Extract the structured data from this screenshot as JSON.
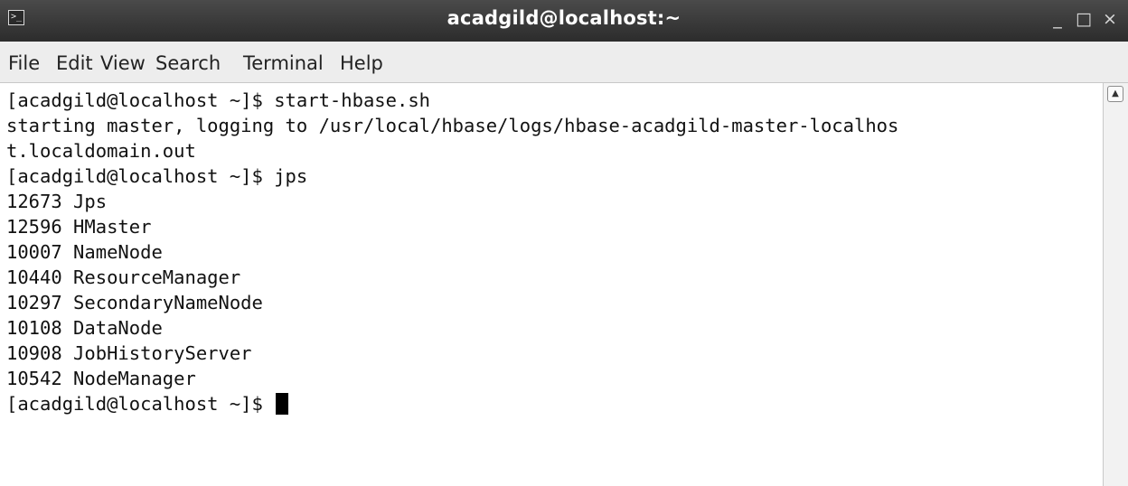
{
  "window": {
    "title": "acadgild@localhost:~",
    "icon": "terminal-icon",
    "controls": {
      "minimize": "_",
      "maximize": "□",
      "close": "×"
    }
  },
  "menubar": {
    "items": [
      "File",
      "Edit",
      "View",
      "Search",
      "Terminal",
      "Help"
    ]
  },
  "terminal": {
    "lines": [
      "[acadgild@localhost ~]$ start-hbase.sh",
      "starting master, logging to /usr/local/hbase/logs/hbase-acadgild-master-localhos",
      "t.localdomain.out",
      "[acadgild@localhost ~]$ jps",
      "12673 Jps",
      "12596 HMaster",
      "10007 NameNode",
      "10440 ResourceManager",
      "10297 SecondaryNameNode",
      "10108 DataNode",
      "10908 JobHistoryServer",
      "10542 NodeManager"
    ],
    "prompt": "[acadgild@localhost ~]$ "
  },
  "scrollbar": {
    "up_arrow": "▲"
  }
}
